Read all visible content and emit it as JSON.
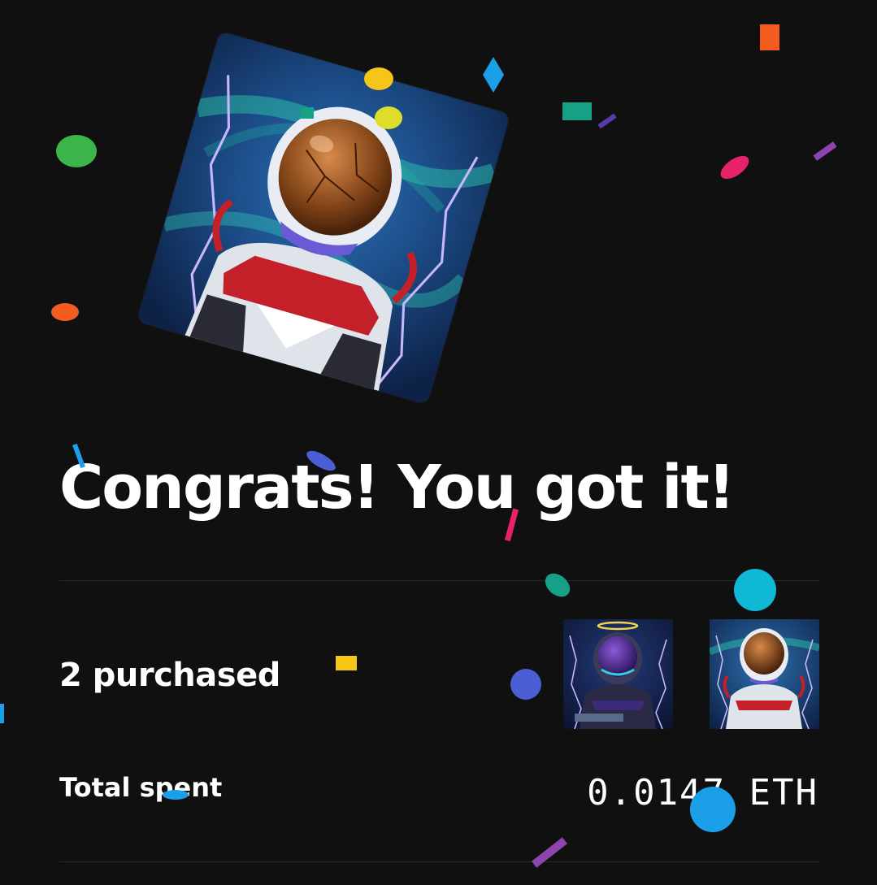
{
  "headline": "Congrats! You got it!",
  "summary": {
    "purchased_label": "2 purchased",
    "total_spent_label": "Total spent",
    "total_spent_value": "0.0147 ETH"
  },
  "colors": {
    "background": "#101011",
    "text": "#ffffff",
    "divider": "#2a2a2e",
    "confetti": [
      "#3bb54a",
      "#f5c518",
      "#f25c1f",
      "#1a9fe8",
      "#e8226a",
      "#16a085",
      "#8e44ad",
      "#0fb8d4",
      "#4a5fd4"
    ]
  },
  "images": {
    "hero": "astronaut-nft-brown-visor-icon",
    "thumbnails": [
      "astronaut-nft-purple-halo-icon",
      "astronaut-nft-brown-visor-icon"
    ]
  }
}
